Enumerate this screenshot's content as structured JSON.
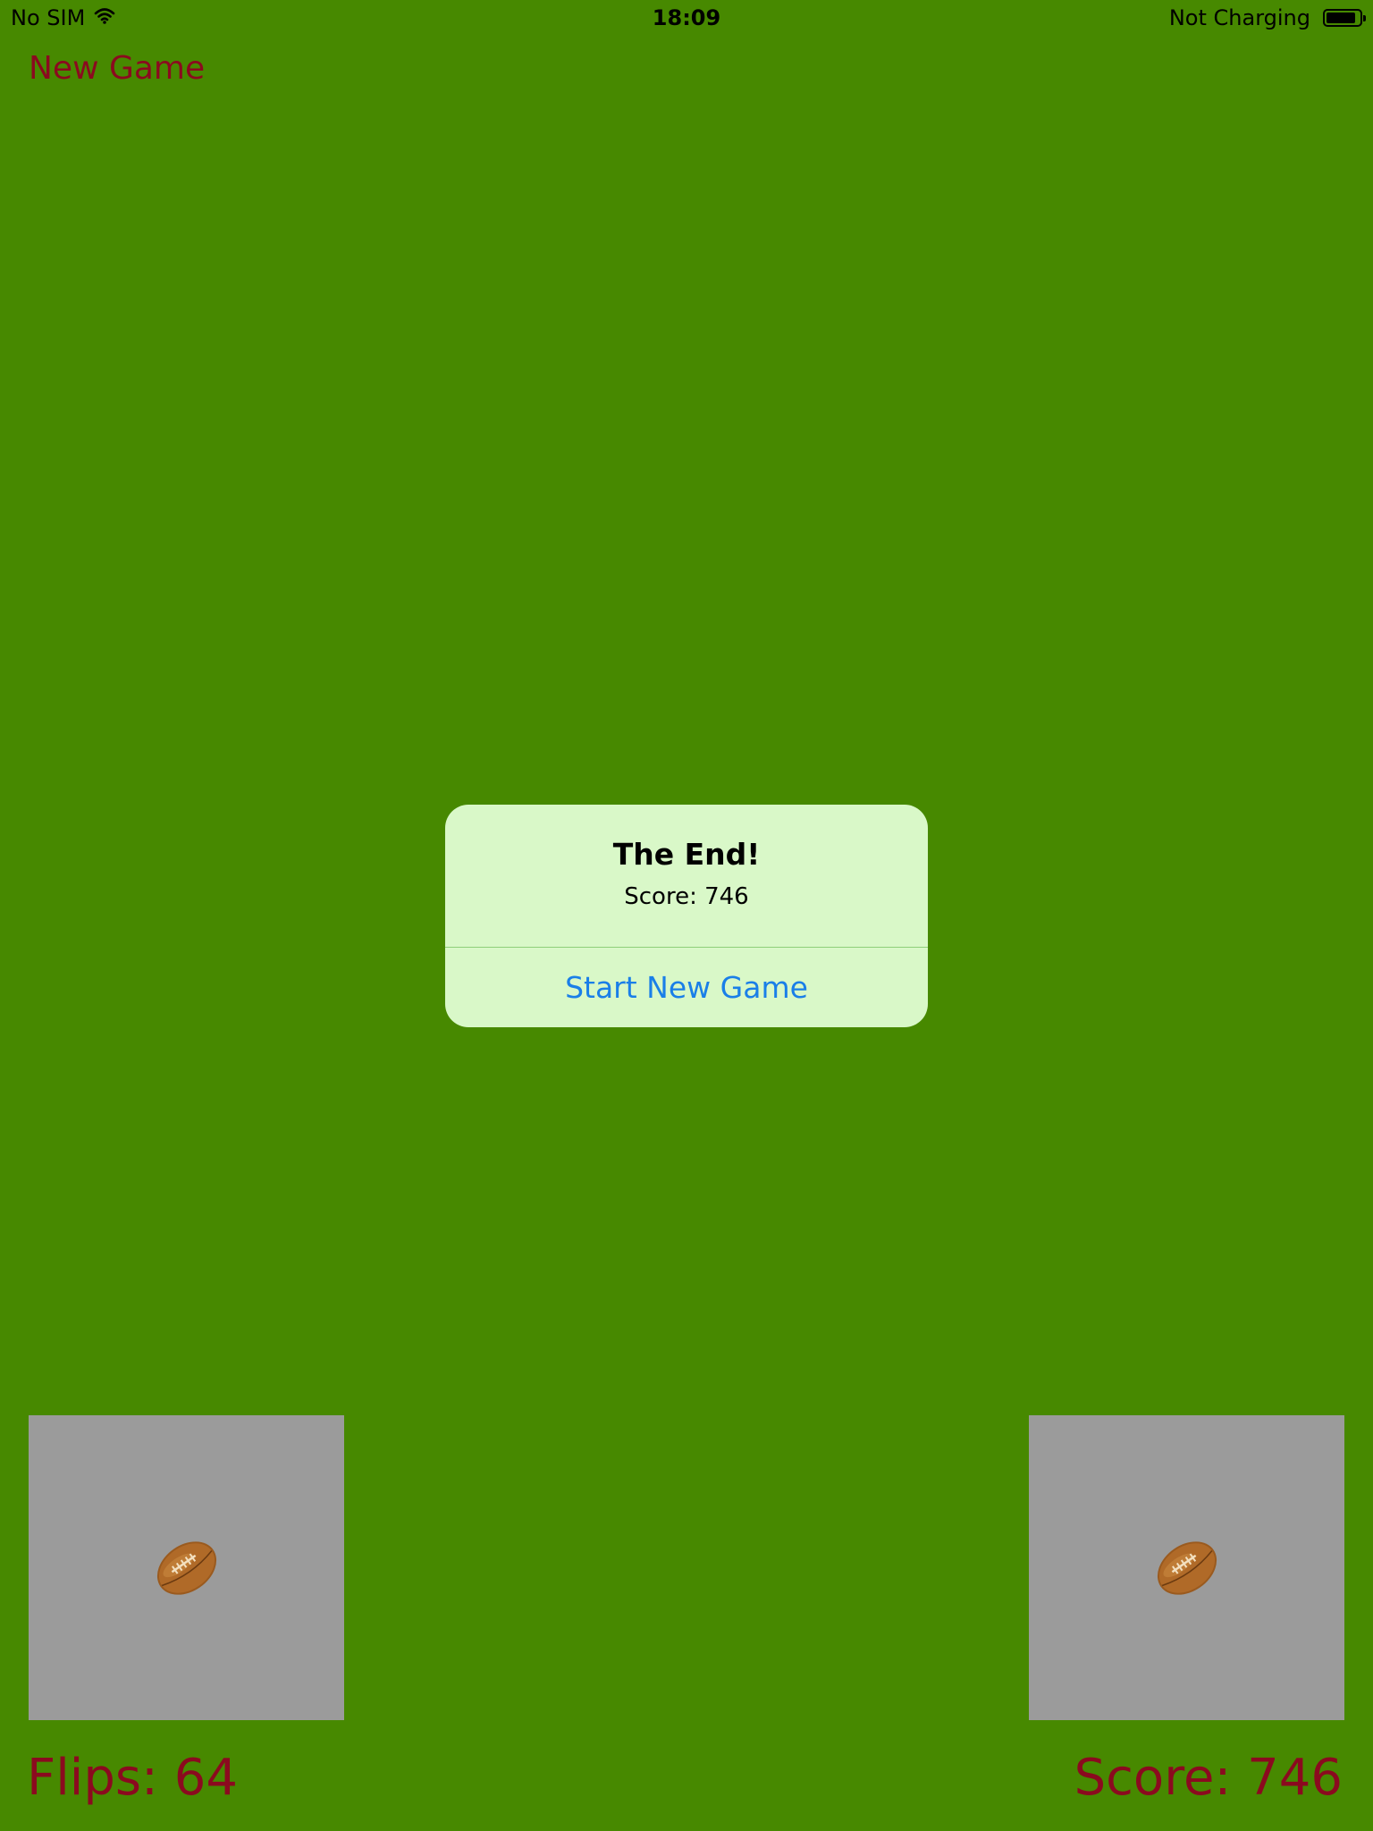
{
  "status_bar": {
    "carrier": "No SIM",
    "time": "18:09",
    "charging_status": "Not Charging",
    "battery_level": 0.9,
    "icons": [
      "wifi-icon",
      "battery-icon"
    ]
  },
  "toolbar": {
    "new_game_label": "New Game"
  },
  "alert": {
    "title": "The End!",
    "message": "Score: 746",
    "button_label": "Start New Game"
  },
  "cards": [
    {
      "emoji": "football-icon",
      "face_up": true
    },
    {
      "emoji": "football-icon",
      "face_up": true
    }
  ],
  "footer": {
    "flips_label": "Flips: 64",
    "score_label": "Score: 746"
  },
  "colors": {
    "background": "#478900",
    "accent_text": "#8b0a1f",
    "alert_background": "#d9f8c8",
    "alert_button_text": "#1a7fe8",
    "card_background": "#9b9b9b"
  }
}
